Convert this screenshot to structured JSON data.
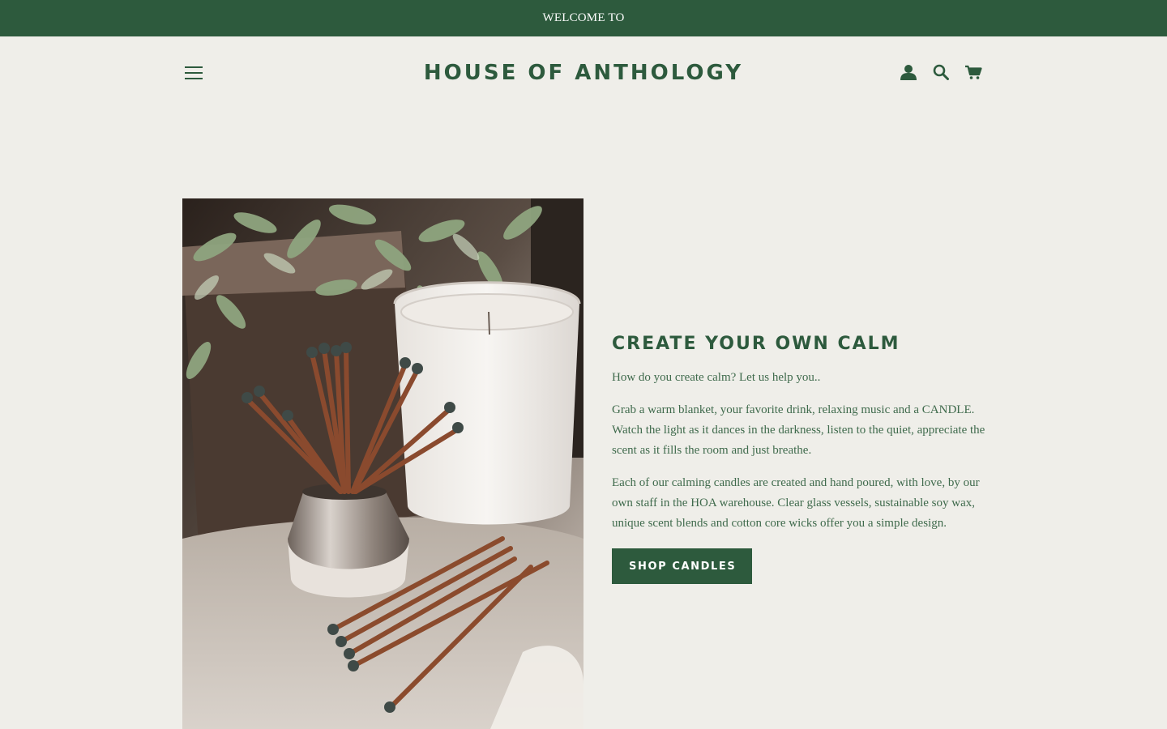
{
  "announcement": {
    "text": "WELCOME TO"
  },
  "header": {
    "logo": "HOUSE OF ANTHOLOGY",
    "icons": {
      "menu": "hamburger-menu-icon",
      "account": "account-icon",
      "search": "search-icon",
      "cart": "cart-icon"
    }
  },
  "feature": {
    "image": "candle-and-matches-photo",
    "title": "CREATE YOUR OWN CALM",
    "paragraphs": [
      "How do you create calm? Let us help you..",
      "Grab a warm blanket, your favorite drink, relaxing music and a CANDLE. Watch the light as it dances in the darkness, listen to the quiet, appreciate the scent as it fills the room and just breathe.",
      "Each of our calming candles are created and hand poured, with love, by our own staff in the HOA warehouse. Clear glass vessels, sustainable soy wax, unique scent blends and cotton core wicks offer you a simple design."
    ],
    "button_label": "SHOP CANDLES"
  },
  "colors": {
    "brand_green": "#2d5a3d",
    "background": "#efeee9",
    "button_text": "#ffffff"
  }
}
